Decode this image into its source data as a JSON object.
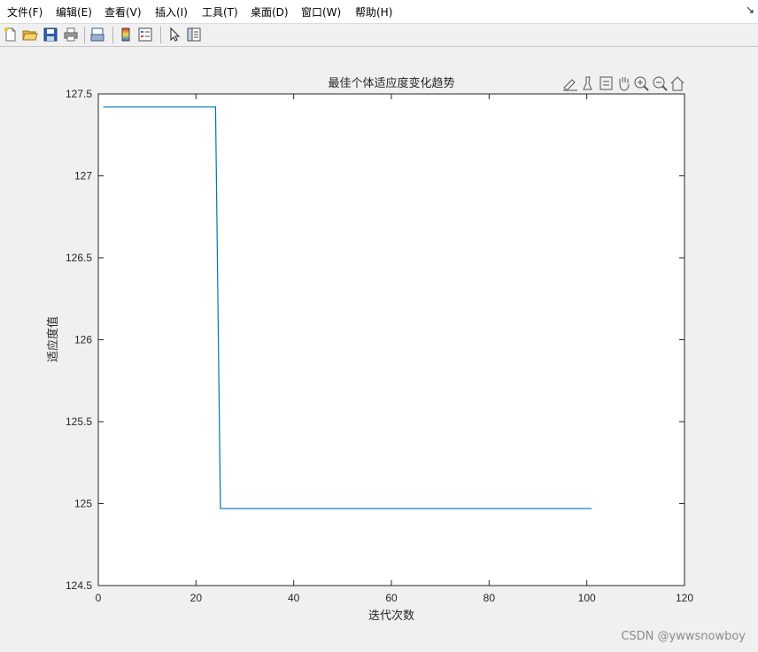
{
  "menu": {
    "items": [
      {
        "label": "文件(F)"
      },
      {
        "label": "编辑(E)"
      },
      {
        "label": "查看(V)"
      },
      {
        "label": "插入(I)"
      },
      {
        "label": "工具(T)"
      },
      {
        "label": "桌面(D)"
      },
      {
        "label": "窗口(W)"
      },
      {
        "label": "帮助(H)"
      }
    ],
    "dock_glyph": "↘"
  },
  "toolbar": {
    "buttons": [
      {
        "icon": "new-file-icon"
      },
      {
        "icon": "open-folder-icon"
      },
      {
        "icon": "save-icon"
      },
      {
        "icon": "print-icon"
      },
      {
        "icon": "link-plot-icon"
      },
      {
        "icon": "insert-colorbar-icon"
      },
      {
        "icon": "insert-legend-icon"
      },
      {
        "icon": "edit-plot-arrow-icon"
      },
      {
        "icon": "property-inspector-icon"
      }
    ]
  },
  "axes_toolbar": {
    "buttons": [
      {
        "icon": "brush-edit-icon"
      },
      {
        "icon": "data-tips-icon"
      },
      {
        "icon": "restore-layout-icon"
      },
      {
        "icon": "pan-hand-icon"
      },
      {
        "icon": "zoom-in-icon"
      },
      {
        "icon": "zoom-out-icon"
      },
      {
        "icon": "home-icon"
      }
    ]
  },
  "chart_data": {
    "type": "line",
    "title": "最佳个体适应度变化趋势",
    "xlabel": "迭代次数",
    "ylabel": "适应度值",
    "xlim": [
      0,
      120
    ],
    "ylim": [
      124.5,
      127.5
    ],
    "xticks": [
      0,
      20,
      40,
      60,
      80,
      100,
      120
    ],
    "xtick_labels": [
      "0",
      "20",
      "40",
      "60",
      "80",
      "100",
      "120"
    ],
    "yticks": [
      124.5,
      125,
      125.5,
      126,
      126.5,
      127,
      127.5
    ],
    "ytick_labels": [
      "124.5",
      "125",
      "125.5",
      "126",
      "126.5",
      "127",
      "127.5"
    ],
    "grid": false,
    "series": [
      {
        "color": "#0072bd",
        "x": [
          1,
          24,
          25,
          101
        ],
        "y": [
          127.42,
          127.42,
          124.97,
          124.97
        ]
      }
    ]
  },
  "watermark": "CSDN @ywwsnowboy"
}
